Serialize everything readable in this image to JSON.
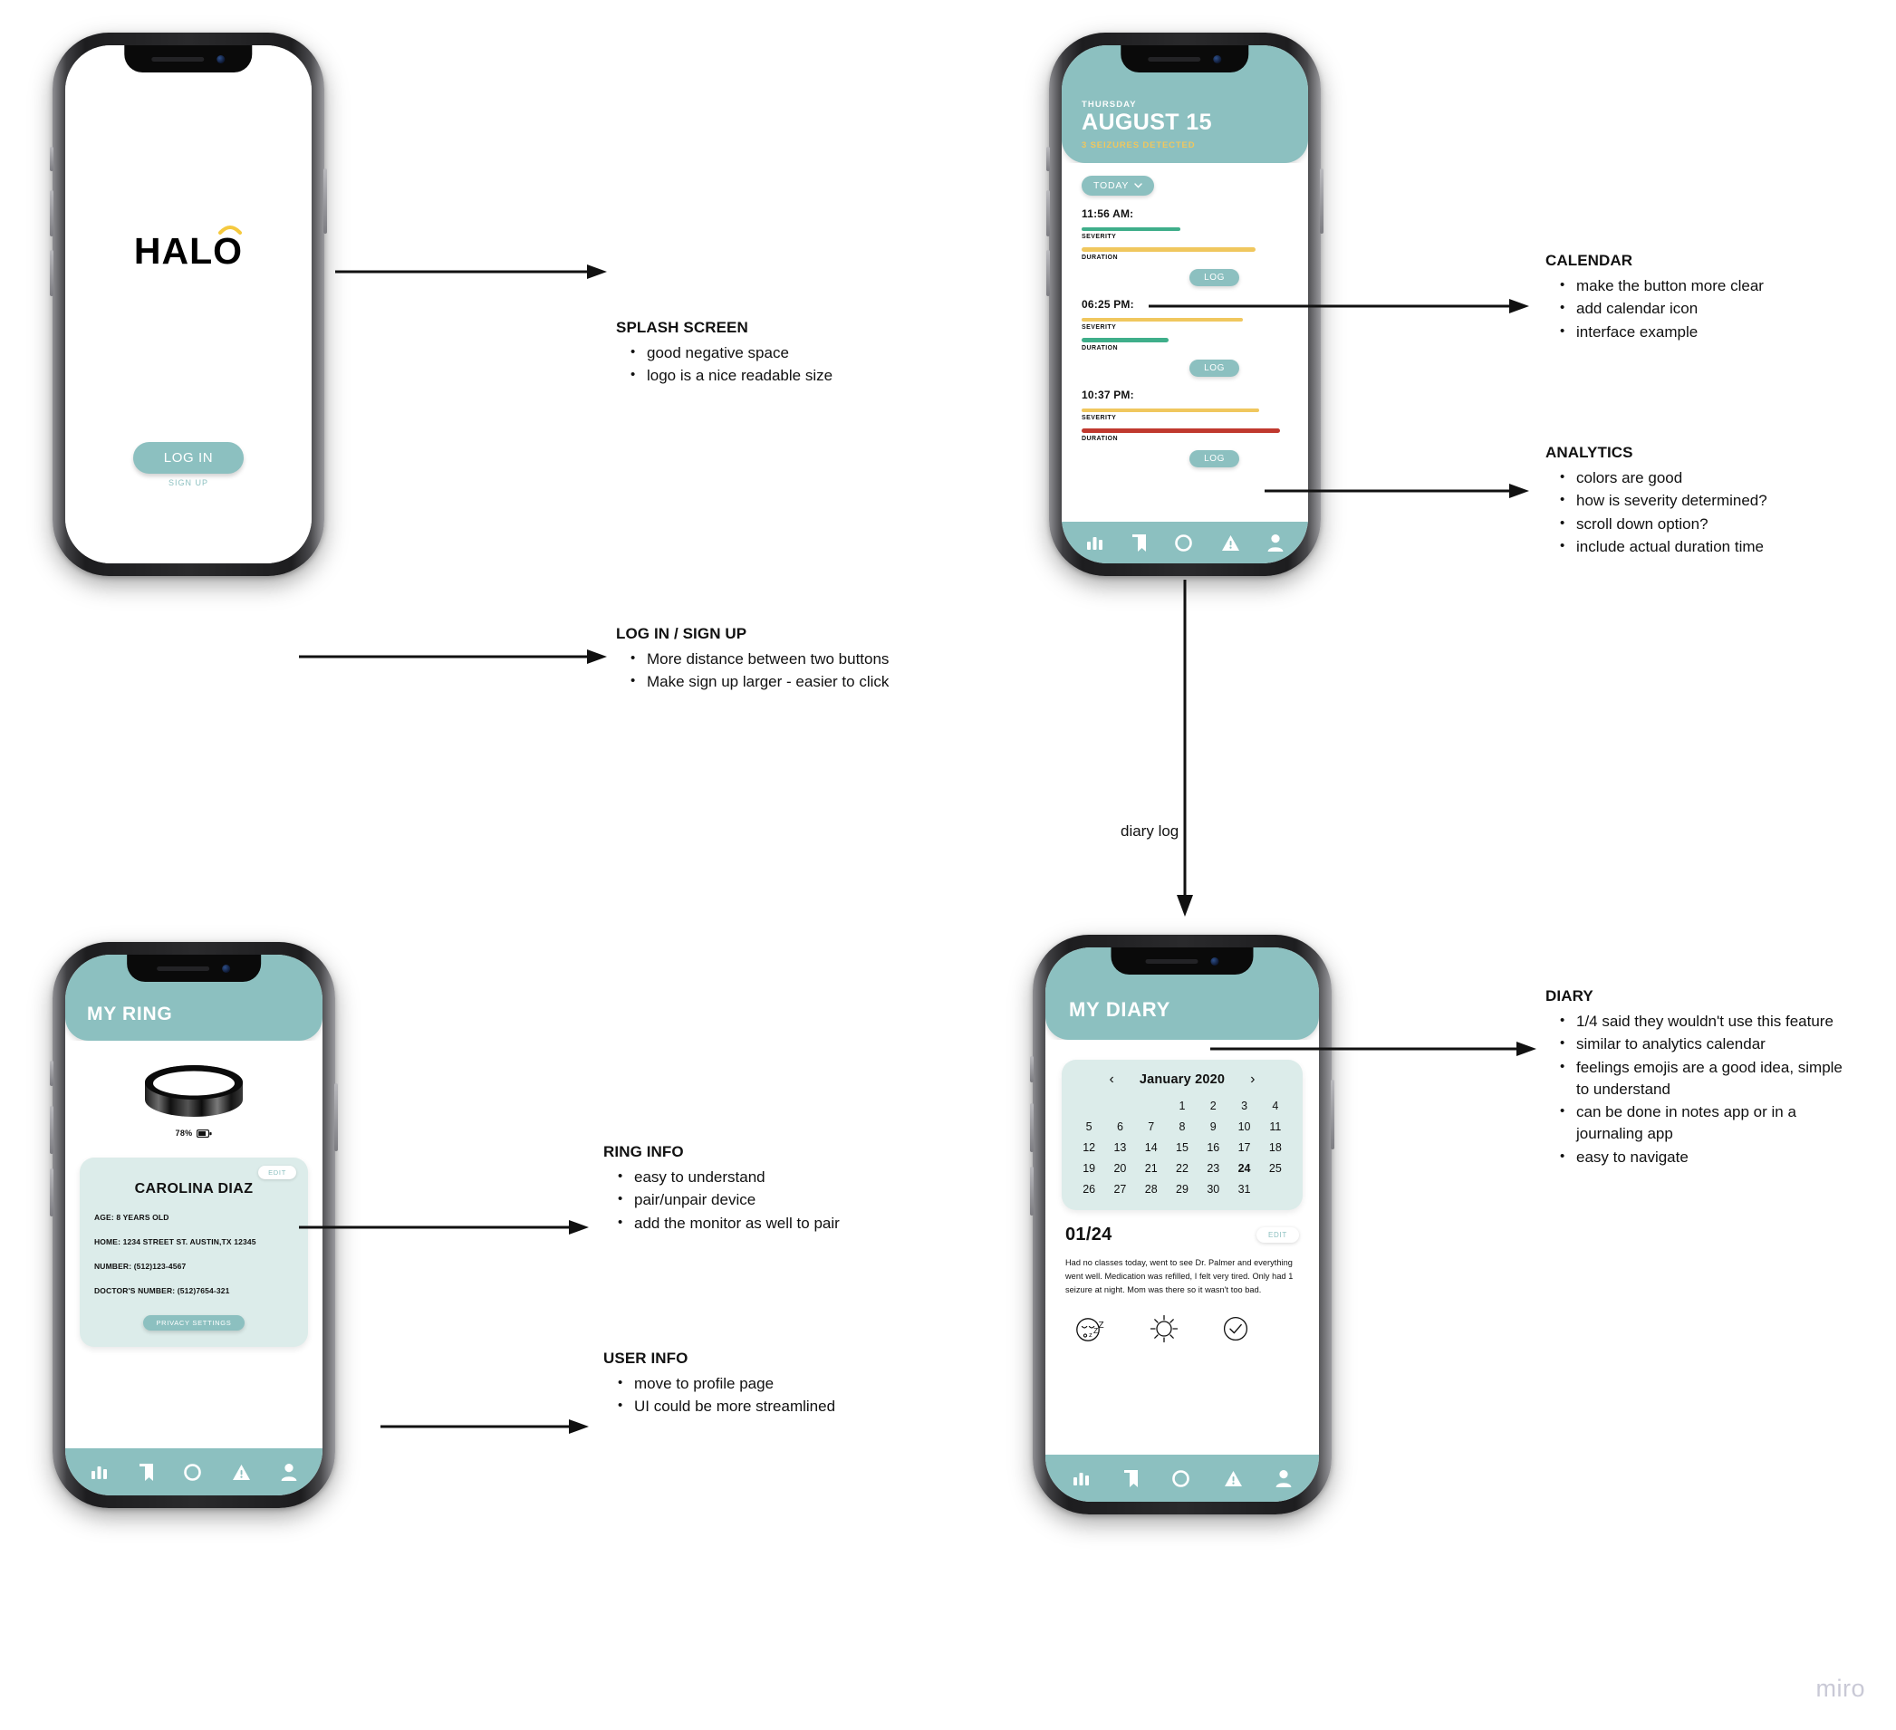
{
  "colors": {
    "teal": "#8cc0c0",
    "card_mint": "#dcecea",
    "yellow": "#f0c75e",
    "green": "#3fae8a",
    "red": "#c0392f",
    "text": "#111111",
    "watermark": "#c9c9d6"
  },
  "watermark": "miro",
  "splash": {
    "logo_text": "HALO",
    "login_label": "LOG IN",
    "signup_label": "SIGN UP"
  },
  "analytics": {
    "weekday": "THURSDAY",
    "date": "AUGUST 15",
    "subtitle": "3 SEIZURES DETECTED",
    "filter_label": "TODAY",
    "severity_label": "SEVERITY",
    "duration_label": "DURATION",
    "log_label": "LOG",
    "entries": [
      {
        "time": "11:56 AM:",
        "severity_color": "#3fae8a",
        "severity_width": 48,
        "duration_color": "#f0c75e",
        "duration_width": 84
      },
      {
        "time": "06:25 PM:",
        "severity_color": "#f0c75e",
        "severity_width": 78,
        "duration_color": "#3fae8a",
        "duration_width": 42
      },
      {
        "time": "10:37 PM:",
        "severity_color": "#f0c75e",
        "severity_width": 86,
        "duration_color": "#c0392f",
        "duration_width": 96
      }
    ]
  },
  "ring": {
    "header_title": "MY RING",
    "battery_pct": "78%",
    "edit_label": "EDIT",
    "user_name": "CAROLINA DIAZ",
    "fields": [
      "AGE: 8 YEARS OLD",
      "HOME: 1234 STREET ST. AUSTIN,TX 12345",
      "NUMBER: (512)123-4567",
      "DOCTOR'S NUMBER: (512)7654-321"
    ],
    "privacy_label": "PRIVACY SETTINGS"
  },
  "diary": {
    "header_title": "MY DIARY",
    "calendar": {
      "month": "January 2020",
      "prev": "‹",
      "next": "›",
      "lead_blanks": 3,
      "days": [
        1,
        2,
        3,
        4,
        5,
        6,
        7,
        8,
        9,
        10,
        11,
        12,
        13,
        14,
        15,
        16,
        17,
        18,
        19,
        20,
        21,
        22,
        23,
        24,
        25,
        26,
        27,
        28,
        29,
        30,
        31
      ],
      "today": 24
    },
    "entry_date": "01/24",
    "edit_label": "EDIT",
    "entry_text": "Had no classes today, went to see Dr. Palmer and everything went well. Medication was refilled, I felt very tired. Only had 1 seizure at night. Mom was there so it wasn't too bad.",
    "moods": [
      "sleepy-face-icon",
      "sun-icon",
      "check-circle-icon"
    ]
  },
  "navbar": {
    "items": [
      {
        "icon": "bar-chart-icon",
        "name": "nav-analytics"
      },
      {
        "icon": "book-icon",
        "name": "nav-diary"
      },
      {
        "icon": "ring-circle-icon",
        "name": "nav-ring"
      },
      {
        "icon": "alert-triangle-icon",
        "name": "nav-alerts"
      },
      {
        "icon": "person-icon",
        "name": "nav-profile"
      }
    ]
  },
  "flow": {
    "diary_log_label": "diary log"
  },
  "annotations": {
    "splash_screen": {
      "title": "SPLASH SCREEN",
      "items": [
        "good negative space",
        "logo is a nice readable size"
      ]
    },
    "login_signup": {
      "title": "LOG IN / SIGN UP",
      "items": [
        "More distance between two buttons",
        "Make sign up larger - easier to click"
      ]
    },
    "calendar": {
      "title": "CALENDAR",
      "items": [
        "make the button more clear",
        "add calendar icon",
        "interface example"
      ]
    },
    "analytics": {
      "title": "ANALYTICS",
      "items": [
        "colors are good",
        "how is severity determined?",
        "scroll down option?",
        "include actual duration time"
      ]
    },
    "ring_info": {
      "title": "RING INFO",
      "items": [
        "easy to understand",
        "pair/unpair device",
        "add the monitor as well to pair"
      ]
    },
    "user_info": {
      "title": "USER INFO",
      "items": [
        "move to profile page",
        "UI could be more streamlined"
      ]
    },
    "diary": {
      "title": "DIARY",
      "items": [
        "1/4 said they wouldn't use this feature",
        "similar to analytics calendar",
        "feelings emojis are a good idea, simple to understand",
        "can be done in notes app or in a journaling app",
        "easy to navigate"
      ]
    }
  }
}
